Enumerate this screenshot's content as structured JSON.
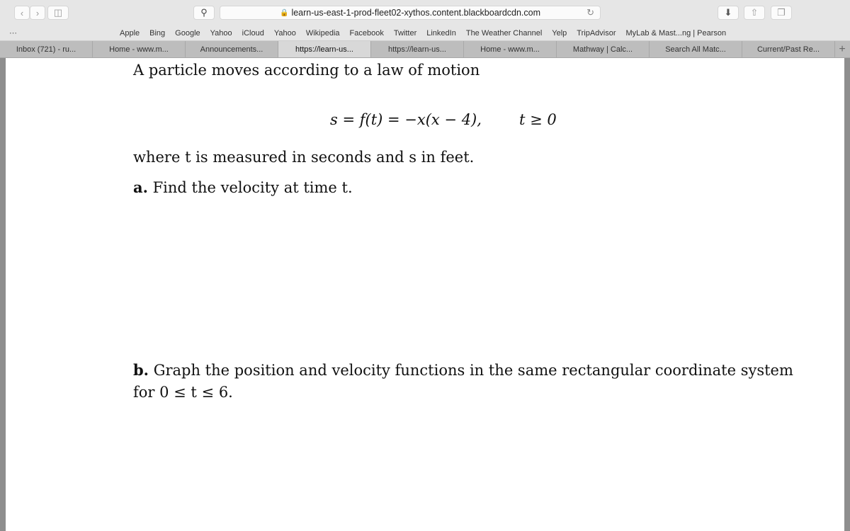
{
  "browser": {
    "url": "learn-us-east-1-prod-fleet02-xythos.content.blackboardcdn.com",
    "bookmarks": [
      "Apple",
      "Bing",
      "Google",
      "Yahoo",
      "iCloud",
      "Yahoo",
      "Wikipedia",
      "Facebook",
      "Twitter",
      "LinkedIn",
      "The Weather Channel",
      "Yelp",
      "TripAdvisor",
      "MyLab & Mast...ng | Pearson"
    ],
    "tabs": [
      "Inbox (721) - ru...",
      "Home - www.m...",
      "Announcements...",
      "https://learn-us...",
      "https://learn-us...",
      "Home - www.m...",
      "Mathway | Calc...",
      "Search All Matc...",
      "Current/Past Re..."
    ],
    "active_tab": 3
  },
  "problem": {
    "intro": "A particle moves according to a law of motion",
    "equation": "s = f(t) = −x(x − 4),",
    "condition": "t ≥ 0",
    "units": "where t is measured in seconds and s in feet.",
    "part_a_label": "a.",
    "part_a": "Find the velocity at time t.",
    "part_b_label": "b.",
    "part_b": "Graph the position and velocity functions in the same rectangular coordinate system",
    "part_b_cont": "for 0 ≤ t ≤ 6."
  }
}
